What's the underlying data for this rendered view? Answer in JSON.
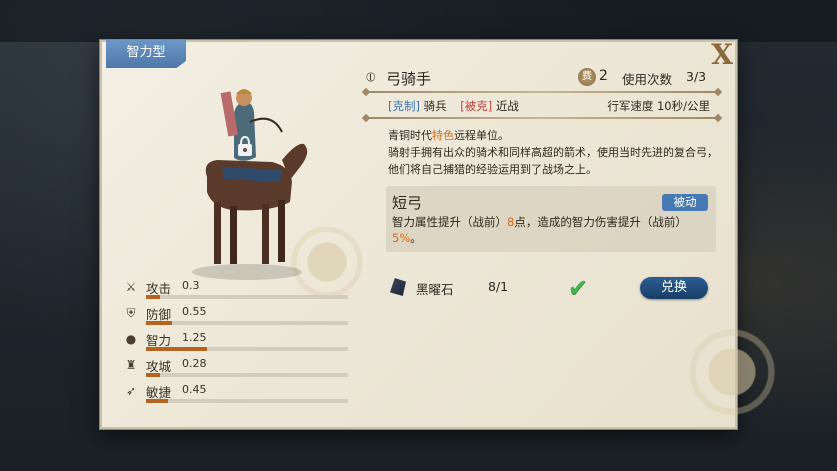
{
  "panel": {
    "type_tab": "智力型",
    "close_label": "X"
  },
  "unit": {
    "name": "弓骑手",
    "cost_badge": "费",
    "cost": "2",
    "uses_label": "使用次数",
    "uses_value": "3/3",
    "counter_tag": "[克制]",
    "counter_target": "骑兵",
    "countered_tag": "[被克]",
    "countered_by": "近战",
    "march_speed": "行军速度  10秒/公里",
    "desc_prefix": "青铜时代",
    "desc_highlight": "特色",
    "desc_rest": "远程单位。",
    "desc_line2": "骑射手拥有出众的骑术和同样高超的箭术，使用当时先进的复合弓，他们将自己捕猎的经验运用到了战场之上。"
  },
  "skill": {
    "name": "短弓",
    "tag": "被动",
    "desc_a": "智力属性提升（战前）",
    "desc_num1": "8",
    "desc_b": "点，造成的智力伤害提升（战前）",
    "desc_num2": "5%",
    "desc_c": "。"
  },
  "stats": [
    {
      "name": "攻击",
      "value": "0.3",
      "fraction": 0.07,
      "icon": "sword-icon"
    },
    {
      "name": "防御",
      "value": "0.55",
      "fraction": 0.13,
      "icon": "shield-icon"
    },
    {
      "name": "智力",
      "value": "1.25",
      "fraction": 0.3,
      "icon": "head-icon"
    },
    {
      "name": "攻城",
      "value": "0.28",
      "fraction": 0.07,
      "icon": "tower-icon"
    },
    {
      "name": "敏捷",
      "value": "0.45",
      "fraction": 0.11,
      "icon": "boot-icon"
    }
  ],
  "item": {
    "name": "黑曜石",
    "count": "8/1",
    "button_label": "兑换"
  },
  "colors": {
    "accent_blue": "#4779b5",
    "highlight_orange": "#d46a1c",
    "stat_fill": "#b5631f",
    "check_green": "#46b24f"
  }
}
